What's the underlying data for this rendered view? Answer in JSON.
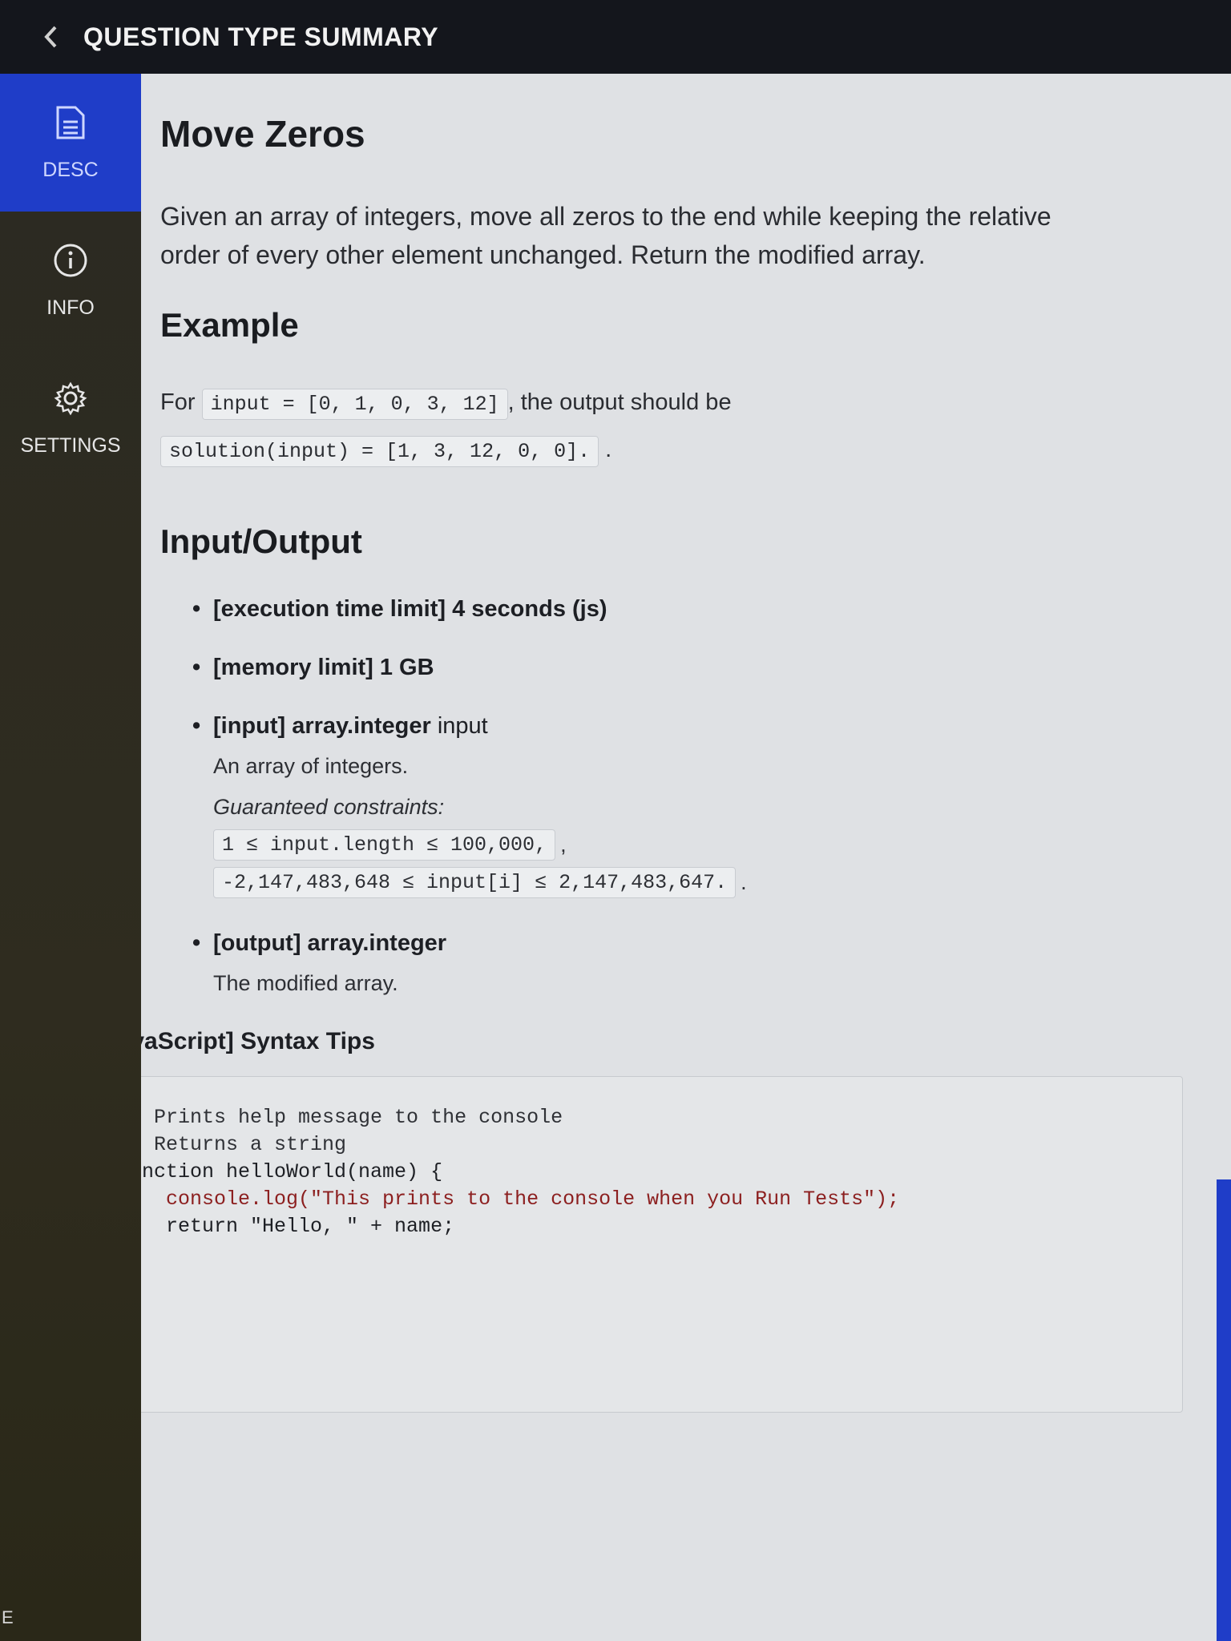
{
  "header": {
    "title": "QUESTION TYPE SUMMARY"
  },
  "sidebar": {
    "items": [
      {
        "label": "DESC",
        "icon": "document-icon",
        "active": true
      },
      {
        "label": "INFO",
        "icon": "info-icon",
        "active": false
      },
      {
        "label": "SETTINGS",
        "icon": "gear-icon",
        "active": false
      }
    ],
    "bottom_fragment": "E"
  },
  "problem": {
    "title": "Move Zeros",
    "description": "Given an array of integers, move all zeros to the end while keeping the relative order of every other element unchanged. Return the modified array.",
    "example_heading": "Example",
    "example_prefix": "For",
    "example_input_code": "input = [0, 1, 0, 3, 12]",
    "example_middle": ", the output should be",
    "example_output_code": "solution(input) = [1, 3, 12, 0, 0].",
    "example_suffix": ".",
    "io_heading": "Input/Output",
    "io": {
      "time_limit": "[execution time limit] 4 seconds (js)",
      "memory_limit": "[memory limit] 1 GB",
      "input_head": "[input] array.integer",
      "input_name": "input",
      "input_desc": "An array of integers.",
      "constraints_label": "Guaranteed constraints:",
      "constraint_1": "1 ≤ input.length ≤ 100,000,",
      "constraint_1_suffix": ",",
      "constraint_2": "-2,147,483,648 ≤ input[i] ≤ 2,147,483,647.",
      "constraint_2_suffix": ".",
      "output_head": "[output] array.integer",
      "output_desc": "The modified array."
    },
    "syntax_title": "[JavaScript] Syntax Tips",
    "code_lines": [
      "// Prints help message to the console",
      "// Returns a string",
      "function helloWorld(name) {",
      "    console.log(\"This prints to the console when you Run Tests\");",
      "    return \"Hello, \" + name;",
      "}"
    ]
  },
  "colors": {
    "accent": "#1f3dc8",
    "content_bg": "#dfe1e4",
    "topbar_bg": "#14161c",
    "sidebar_bg": "#2b2a22"
  }
}
